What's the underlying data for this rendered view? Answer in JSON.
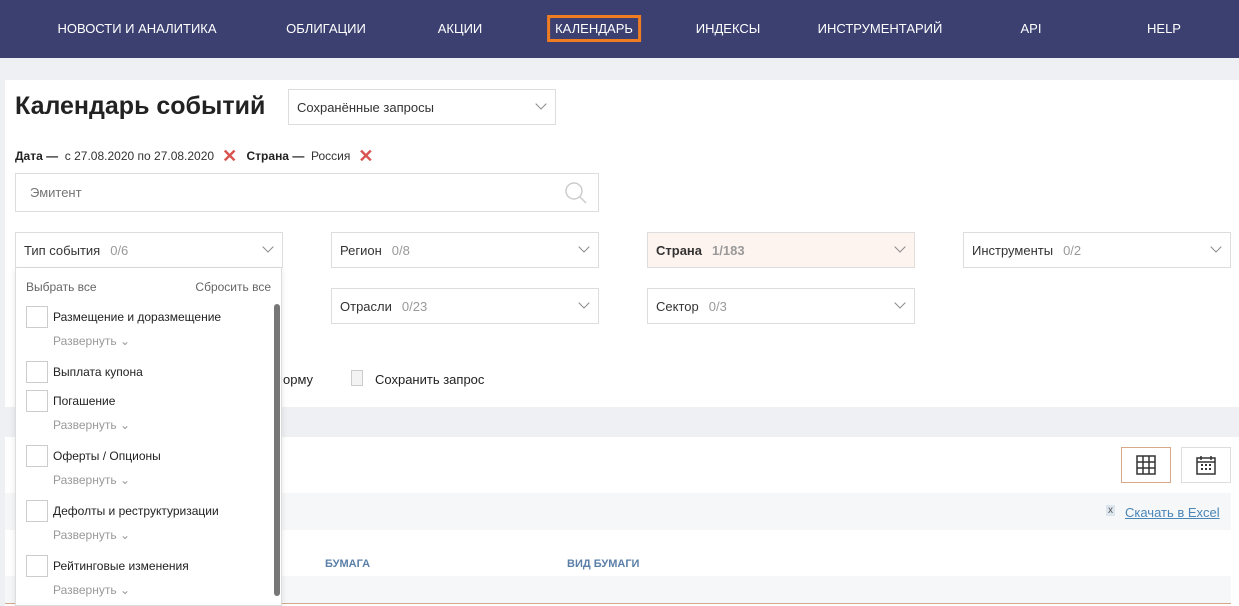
{
  "nav": {
    "items": [
      {
        "label": "НОВОСТИ И АНАЛИТИКА"
      },
      {
        "label": "ОБЛИГАЦИИ"
      },
      {
        "label": "АКЦИИ"
      },
      {
        "label": "КАЛЕНДАРЬ",
        "active": true
      },
      {
        "label": "ИНДЕКСЫ"
      },
      {
        "label": "ИНСТРУМЕНТАРИЙ"
      },
      {
        "label": "API"
      },
      {
        "label": "HELP"
      }
    ],
    "accent": "#f07c22",
    "background": "#3b4070"
  },
  "page": {
    "title": "Календарь событий",
    "saved_queries": "Сохранённые запросы"
  },
  "filters": {
    "date_label": "Дата —",
    "date_value": "с 27.08.2020 по 27.08.2020",
    "country_label": "Страна —",
    "country_value": "Россия"
  },
  "search": {
    "placeholder": "Эмитент"
  },
  "selects": {
    "event_type": {
      "label": "Тип события",
      "count": "0/6"
    },
    "region": {
      "label": "Регион",
      "count": "0/8"
    },
    "country": {
      "label": "Страна",
      "count": "1/183"
    },
    "instruments": {
      "label": "Инструменты",
      "count": "0/2"
    },
    "industries": {
      "label": "Отрасли",
      "count": "0/23"
    },
    "sector": {
      "label": "Сектор",
      "count": "0/3"
    }
  },
  "dropdown": {
    "select_all": "Выбрать все",
    "reset_all": "Сбросить все",
    "expand": "Развернуть",
    "items": [
      "Размещение и доразмещение",
      "Выплата купона",
      "Погашение",
      "Оферты / Опционы",
      "Дефолты и реструктуризации",
      "Рейтинговые изменения"
    ]
  },
  "actions": {
    "clear_partial": "орму",
    "save_query": "Сохранить запрос"
  },
  "results": {
    "excel": "Скачать в Excel",
    "columns": [
      "БУМАГА",
      "ВИД БУМАГИ"
    ]
  }
}
